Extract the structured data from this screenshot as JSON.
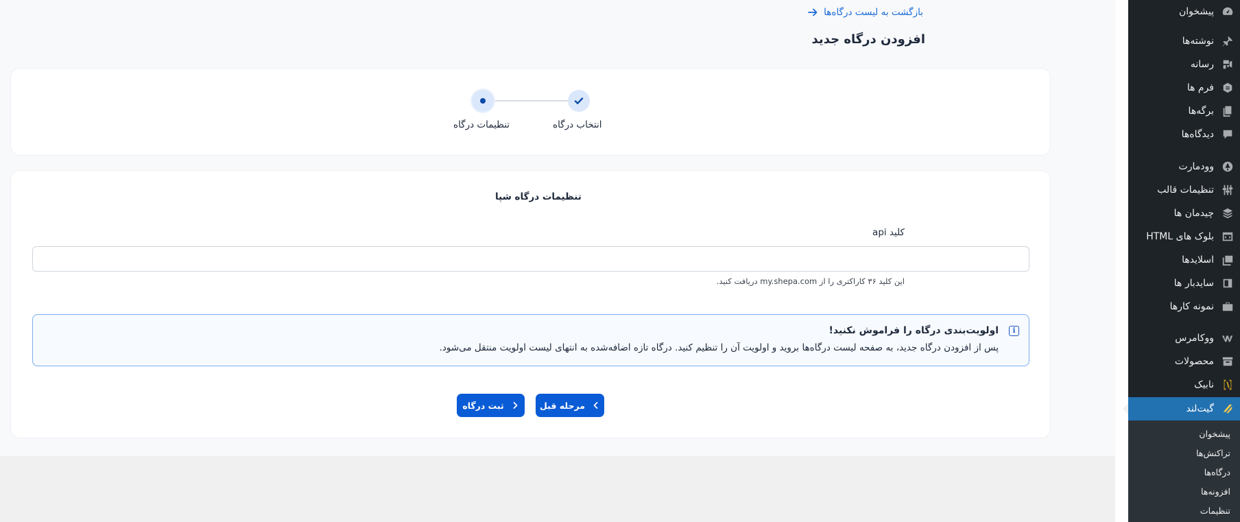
{
  "back_link": {
    "label": "بازگشت به لیست درگاه‌ها"
  },
  "page_title": "افزودن درگاه جدید",
  "stepper": {
    "steps": [
      {
        "label": "انتخاب درگاه",
        "state": "done"
      },
      {
        "label": "تنظیمات درگاه",
        "state": "current"
      }
    ]
  },
  "form": {
    "section_title": "تنظیمات درگاه شپا",
    "api_key_label": "کلید api",
    "api_key_value": "",
    "api_key_hint": "این کلید ۳۶ کاراکتری را از my.shepa.com دریافت کنید."
  },
  "notice": {
    "title": "اولویت‌بندی درگاه را فراموش نکنید!",
    "body": "پس از افزودن درگاه جدید، به صفحه لیست درگاه‌ها بروید و اولویت آن را تنظیم کنید. درگاه تازه اضافه‌شده به انتهای لیست اولویت منتقل می‌شود."
  },
  "buttons": {
    "prev_label": "مرحله قبل",
    "submit_label": "ثبت درگاه"
  },
  "sidebar": {
    "items": [
      {
        "label": "پیشخوان",
        "icon": "dashboard-icon"
      },
      {
        "label": "نوشته‌ها",
        "icon": "pin-icon"
      },
      {
        "label": "رسانه",
        "icon": "media-icon"
      },
      {
        "label": "فرم ها",
        "icon": "forms-icon"
      },
      {
        "label": "برگه‌ها",
        "icon": "pages-icon"
      },
      {
        "label": "دیدگاه‌ها",
        "icon": "comments-icon"
      },
      {
        "label": "وودمارت",
        "icon": "woodmart-icon"
      },
      {
        "label": "تنظیمات قالب",
        "icon": "sliders-icon"
      },
      {
        "label": "چیدمان ها",
        "icon": "layers-icon"
      },
      {
        "label": "بلوک های HTML",
        "icon": "html-block-icon"
      },
      {
        "label": "اسلایدها",
        "icon": "slides-icon"
      },
      {
        "label": "سایدبار ها",
        "icon": "sidebar-icon"
      },
      {
        "label": "نمونه کارها",
        "icon": "portfolio-icon"
      },
      {
        "label": "ووکامرس",
        "icon": "woocommerce-icon"
      },
      {
        "label": "محصولات",
        "icon": "products-icon"
      },
      {
        "label": "نابیک",
        "icon": "nabik-icon"
      },
      {
        "label": "گیت‌لند",
        "icon": "gateland-icon",
        "active": true
      }
    ],
    "submenu": [
      "پیشخوان",
      "تراکنش‌ها",
      "درگاه‌ها",
      "افزونه‌ها",
      "تنظیمات"
    ]
  },
  "colors": {
    "primary": "#0a5bd6",
    "sidebar_bg": "#1d2327",
    "sidebar_active": "#2271b1",
    "notice_border": "#7aaef0"
  }
}
